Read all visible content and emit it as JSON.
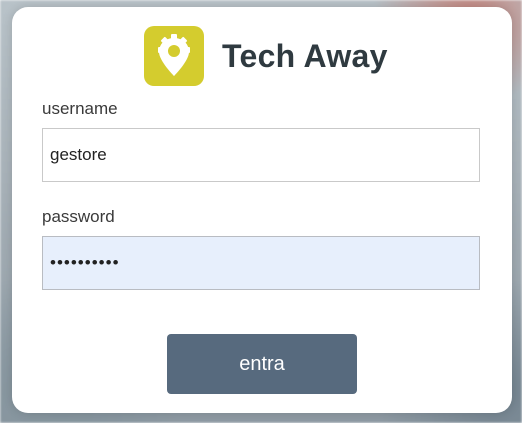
{
  "brand": {
    "name": "Tech Away",
    "logo_icon": "map-pin-gear-icon",
    "logo_color": "#d4cc2e"
  },
  "form": {
    "username_label": "username",
    "username_value": "gestore",
    "password_label": "password",
    "password_value": "••••••••••",
    "submit_label": "entra",
    "submit_color": "#576a7e"
  }
}
